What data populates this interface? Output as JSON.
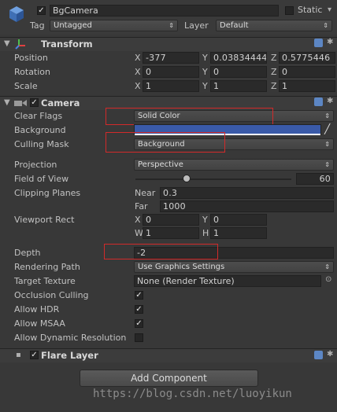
{
  "top": {
    "name": "BgCamera",
    "static_label": "Static",
    "tag_label": "Tag",
    "tag_value": "Untagged",
    "layer_label": "Layer",
    "layer_value": "Default"
  },
  "transform": {
    "title": "Transform",
    "position_label": "Position",
    "rotation_label": "Rotation",
    "scale_label": "Scale",
    "position": {
      "x": "-377",
      "y": "0.03834444",
      "z": "0.5775446"
    },
    "rotation": {
      "x": "0",
      "y": "0",
      "z": "0"
    },
    "scale": {
      "x": "1",
      "y": "1",
      "z": "1"
    }
  },
  "axes": {
    "x": "X",
    "y": "Y",
    "z": "Z",
    "w": "W",
    "h": "H"
  },
  "camera": {
    "title": "Camera",
    "clear_flags_label": "Clear Flags",
    "clear_flags_value": "Solid Color",
    "background_label": "Background",
    "background_color": "#3a5aa8",
    "culling_mask_label": "Culling Mask",
    "culling_mask_value": "Background",
    "projection_label": "Projection",
    "projection_value": "Perspective",
    "fov_label": "Field of View",
    "fov_value": "60",
    "clipping_label": "Clipping Planes",
    "near_label": "Near",
    "near_value": "0.3",
    "far_label": "Far",
    "far_value": "1000",
    "viewport_label": "Viewport Rect",
    "viewport": {
      "x": "0",
      "y": "0",
      "w": "1",
      "h": "1"
    },
    "depth_label": "Depth",
    "depth_value": "-2",
    "rendering_path_label": "Rendering Path",
    "rendering_path_value": "Use Graphics Settings",
    "target_texture_label": "Target Texture",
    "target_texture_value": "None (Render Texture)",
    "occlusion_label": "Occlusion Culling",
    "hdr_label": "Allow HDR",
    "msaa_label": "Allow MSAA",
    "dynres_label": "Allow Dynamic Resolution"
  },
  "flare": {
    "title": "Flare Layer"
  },
  "add_component_label": "Add Component",
  "watermark": "https://blog.csdn.net/luoyikun",
  "colors": {
    "highlight": "#d22a2a",
    "background": "#383838"
  }
}
